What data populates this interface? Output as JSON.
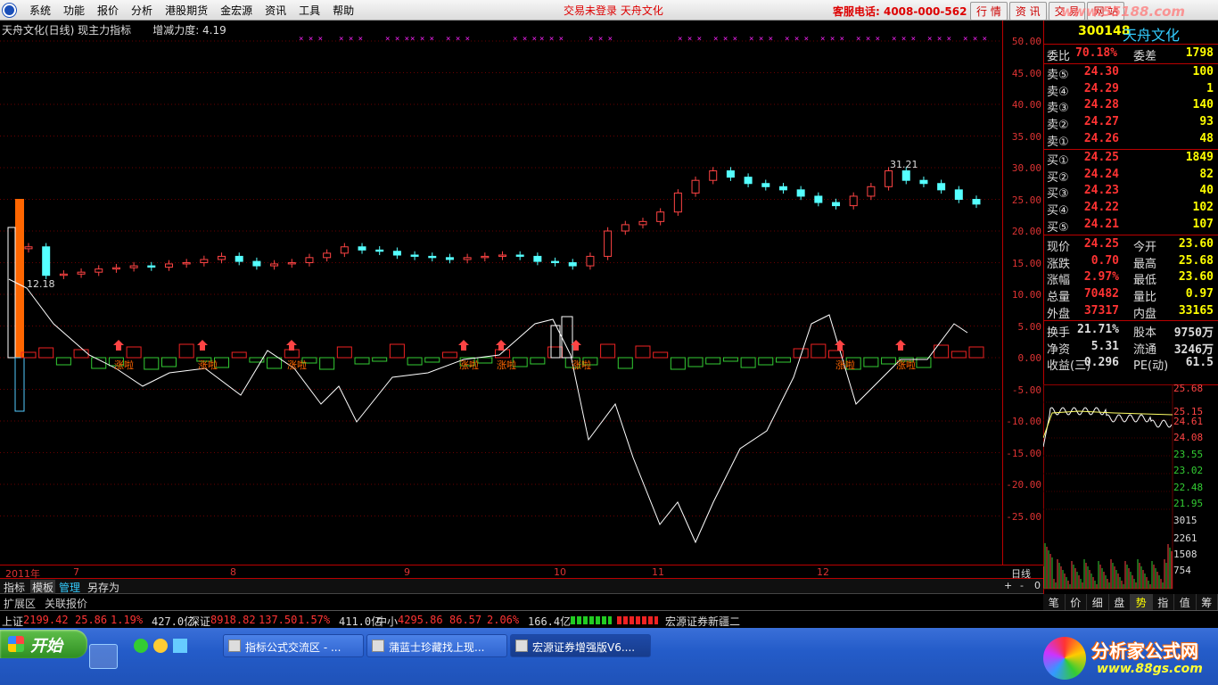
{
  "menu": [
    "系统",
    "功能",
    "报价",
    "分析",
    "港股期货",
    "金宏源",
    "资讯",
    "工具",
    "帮助"
  ],
  "status": "交易未登录  天舟文化",
  "hotline": "客服电话: 4008-000-562",
  "top_tabs": [
    "行 情",
    "资 讯",
    "交 易",
    "网 站"
  ],
  "watermark": "www.55188.com",
  "chart": {
    "title": "天舟文化(日线) 现主力指标",
    "param": "增减力度: 4.19",
    "high_label": "31.21",
    "low_label": "12.18",
    "marker_text": "涨啦",
    "axis": [
      "50.00",
      "45.00",
      "40.00",
      "35.00",
      "30.00",
      "25.00",
      "20.00",
      "15.00",
      "10.00",
      "5.00",
      "0.00",
      "-5.00",
      "-10.00",
      "-15.00",
      "-20.00",
      "-25.00"
    ],
    "dates": [
      "2011年",
      "7",
      "8",
      "9",
      "10",
      "11",
      "12"
    ],
    "date_right": "日线"
  },
  "chart_data": {
    "type": "candlestick",
    "price_axis": [
      -25,
      50
    ],
    "close_approx": [
      17.5,
      13.0,
      13.2,
      13.5,
      14.0,
      14.2,
      14.5,
      14.3,
      14.8,
      15.0,
      15.5,
      16.0,
      15.2,
      14.5,
      14.8,
      15.0,
      15.8,
      16.5,
      17.5,
      17.0,
      16.8,
      16.2,
      16.0,
      15.8,
      15.5,
      15.8,
      16.0,
      16.2,
      16.0,
      15.2,
      15.0,
      14.5,
      16.0,
      20.0,
      21.0,
      21.5,
      23.0,
      26.0,
      28.0,
      29.5,
      28.5,
      27.5,
      27.0,
      26.5,
      25.5,
      24.5,
      24.0,
      25.5,
      27.0,
      29.5,
      28.0,
      27.5,
      26.5,
      25.0,
      24.25
    ]
  },
  "tabs": [
    "指标",
    "模板",
    "管理",
    "另存为"
  ],
  "tab_ctrl": [
    "+",
    "-",
    "0"
  ],
  "ext_tabs": [
    "扩展区",
    "关联报价"
  ],
  "quote": {
    "code": "300148",
    "name": "天舟文化",
    "wb_label": "委比",
    "wb": "70.18%",
    "wc_label": "委差",
    "wc": "1798",
    "sells": [
      [
        "卖⑤",
        "24.30",
        "100"
      ],
      [
        "卖④",
        "24.29",
        "1"
      ],
      [
        "卖③",
        "24.28",
        "140"
      ],
      [
        "卖②",
        "24.27",
        "93"
      ],
      [
        "卖①",
        "24.26",
        "48"
      ]
    ],
    "buys": [
      [
        "买①",
        "24.25",
        "1849"
      ],
      [
        "买②",
        "24.24",
        "82"
      ],
      [
        "买③",
        "24.23",
        "40"
      ],
      [
        "买④",
        "24.22",
        "102"
      ],
      [
        "买⑤",
        "24.21",
        "107"
      ]
    ],
    "stats": [
      [
        "现价",
        "24.25",
        "今开",
        "23.60"
      ],
      [
        "涨跌",
        "0.70",
        "最高",
        "25.68"
      ],
      [
        "涨幅",
        "2.97%",
        "最低",
        "23.60"
      ],
      [
        "总量",
        "70482",
        "量比",
        "0.97"
      ],
      [
        "外盘",
        "37317",
        "内盘",
        "33165"
      ]
    ],
    "stats2": [
      [
        "换手",
        "21.71%",
        "股本",
        "9750万"
      ],
      [
        "净资",
        "5.31",
        "流通",
        "3246万"
      ],
      [
        "收益(三)",
        "0.296",
        "PE(动)",
        "61.5"
      ]
    ]
  },
  "mini_axis": [
    "25.68",
    "25.15",
    "24.61",
    "24.08",
    "23.55",
    "23.02",
    "22.48",
    "21.95",
    "3015",
    "2261",
    "1508",
    "754"
  ],
  "right_tabs": [
    "笔",
    "价",
    "细",
    "盘",
    "势",
    "指",
    "值",
    "筹"
  ],
  "ticker": {
    "sh_label": "上证",
    "sh": "2199.42",
    "sh_chg": "25.86",
    "sh_pct": "1.19%",
    "sh_amt": "427.0亿",
    "sz_label": "深证",
    "sz": "8918.82",
    "sz_chg": "137.50",
    "sz_pct": "1.57%",
    "sz_amt": "411.0亿",
    "zx_label": "中小",
    "zx": "4295.86",
    "zx_chg": "86.57",
    "zx_pct": "2.06%",
    "zx_amt": "166.4亿",
    "broker": "宏源证券新疆二"
  },
  "taskbar": {
    "start": "开始",
    "tasks": [
      "指标公式交流区 - ...",
      "蒲蓝士珍藏找上现...",
      "宏源证券增强版V6...."
    ],
    "brand": "分析家公式网",
    "brand_url": "www.88gs.com"
  }
}
